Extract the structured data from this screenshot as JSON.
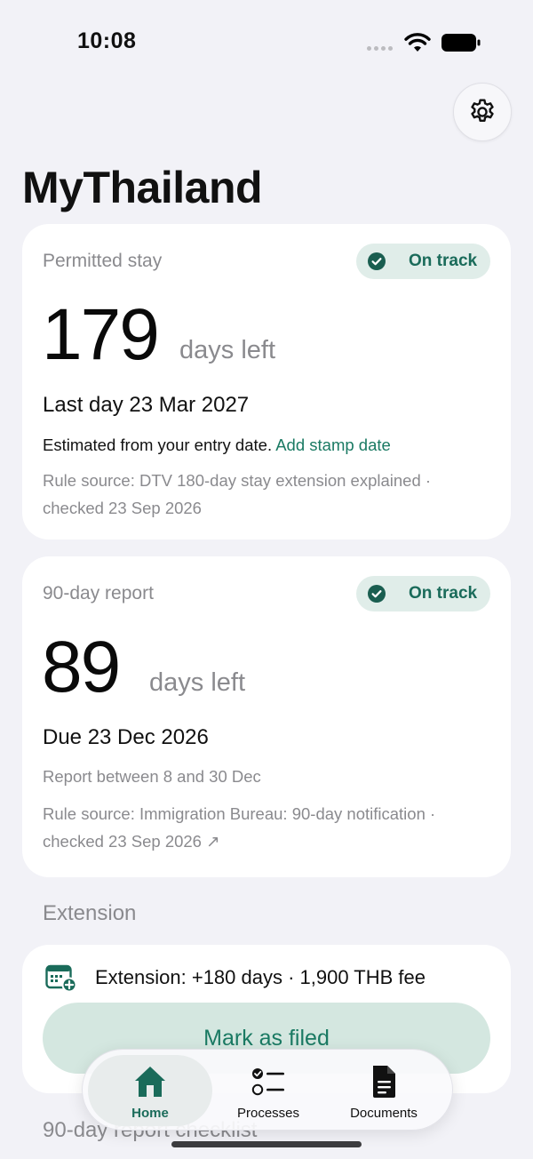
{
  "status_bar": {
    "time": "10:08"
  },
  "app": {
    "title": "MyThailand"
  },
  "permitted_stay": {
    "label": "Permitted stay",
    "badge": "On track",
    "days": "179",
    "days_suffix": "days left",
    "last_day": "Last day 23 Mar 2027",
    "estimate_text": "Estimated from your entry date.",
    "estimate_link": "Add stamp date",
    "rule_source": "Rule source: DTV 180-day stay extension explained · checked 23 Sep 2026"
  },
  "report_90": {
    "label": "90-day report",
    "badge": "On track",
    "days": "89",
    "days_suffix": "days left",
    "due": "Due 23 Dec 2026",
    "window": "Report between 8 and 30 Dec",
    "rule_source": "Rule source: Immigration Bureau: 90-day notification · checked 23 Sep 2026 ↗"
  },
  "extension": {
    "section_heading": "Extension",
    "summary": "Extension: +180 days · 1,900 THB fee",
    "button": "Mark as filed"
  },
  "checklist": {
    "section_heading": "90-day report checklist"
  },
  "tabs": [
    {
      "label": "Home",
      "icon": "home-icon"
    },
    {
      "label": "Processes",
      "icon": "checklist-icon"
    },
    {
      "label": "Documents",
      "icon": "document-icon"
    }
  ],
  "colors": {
    "accent": "#1a7a63",
    "badge_bg": "#e0ede9",
    "background": "#f2f2f7"
  }
}
